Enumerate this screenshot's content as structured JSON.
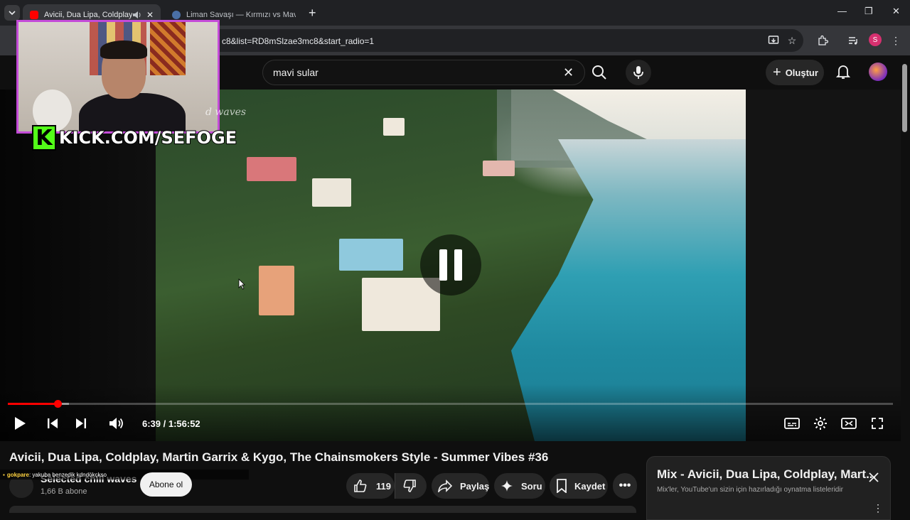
{
  "browser": {
    "tabs": [
      {
        "title": "Avicii, Dua Lipa, Coldplay, M",
        "active": true
      },
      {
        "title": "Liman Savaşı — Kırmızı vs Mavi",
        "active": false
      }
    ],
    "url": "c8&list=RD8mSlzae3mc8&start_radio=1",
    "profile_initial": "S"
  },
  "header": {
    "search_value": "mavi sular",
    "create_label": "Oluştur"
  },
  "player": {
    "time": "6:39 / 1:56:52",
    "progress_fraction": 0.057,
    "buffered_fraction": 0.069,
    "state_icon": "pause-icon"
  },
  "overlay": {
    "kick_logo": "K",
    "kick_text": "KICK.COM/SEFOGE",
    "watermark": "d waves"
  },
  "video": {
    "title": "Avicii, Dua Lipa, Coldplay, Martin Garrix & Kygo, The Chainsmokers Style - Summer Vibes #36",
    "channel": "Selected chill waves",
    "subscribers": "1,66 B abone",
    "subscribe_label": "Abone ol",
    "likes": "119",
    "share_label": "Paylaş",
    "ask_label": "Soru",
    "save_label": "Kaydet"
  },
  "chat": {
    "user": "gokpare",
    "message": ": yakuba benzedik kdndökçkso"
  },
  "mix": {
    "title": "Mix - Avicii, Dua Lipa, Coldplay, Mart...",
    "subtitle": "Mix'ler, YouTube'un sizin için hazırladığı oynatma listeleridir"
  },
  "colors": {
    "accent_red": "#ff0000",
    "kick_green": "#53fc18",
    "webcam_border": "#c44bd8"
  }
}
